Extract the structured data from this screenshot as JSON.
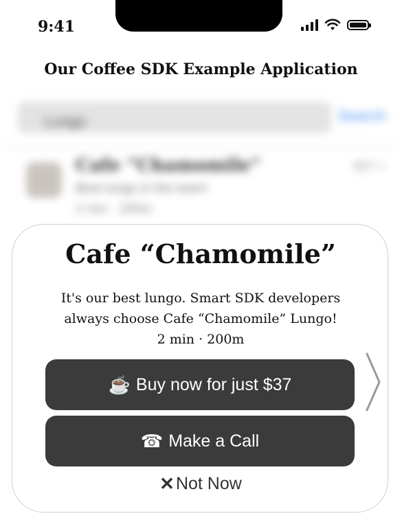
{
  "status_bar": {
    "time": "9:41"
  },
  "app": {
    "title": "Our Coffee SDK Example Application"
  },
  "background": {
    "search": {
      "query": "Lungo",
      "button_label": "Search"
    },
    "list_item": {
      "title": "Cafe “Chamomile”",
      "subtitle": "Best lungo in the town!",
      "meta": "2 min · 200m",
      "side": "$37 >"
    }
  },
  "modal": {
    "title": "Cafe “Chamomile”",
    "description_lines": [
      "It's our best lungo. Smart SDK developers",
      "always choose Cafe “Chamomile” Lungo!",
      "2 min · 200m"
    ],
    "buy_button": {
      "icon": "☕",
      "label": "Buy now for just $37"
    },
    "call_button": {
      "icon": "☎",
      "label": "Make a Call"
    },
    "dismiss": {
      "icon": "✕",
      "label": "Not Now"
    }
  }
}
